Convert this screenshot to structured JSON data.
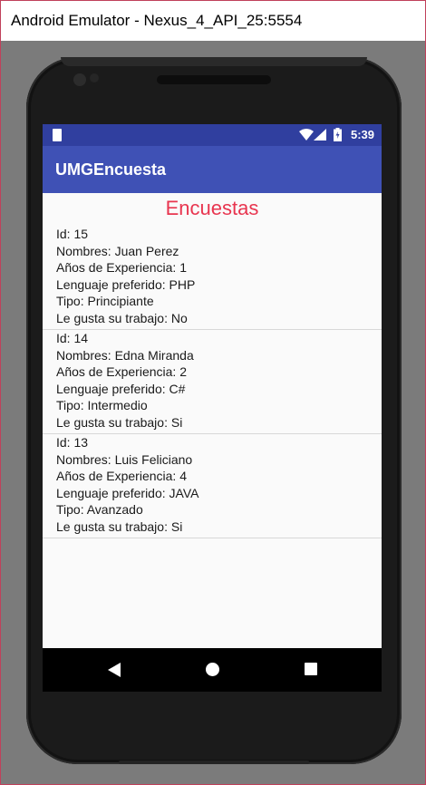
{
  "window": {
    "title": "Android Emulator - Nexus_4_API_25:5554"
  },
  "status_bar": {
    "time": "5:39",
    "icons": [
      "sim-card-icon",
      "wifi-icon",
      "cell-signal-icon",
      "battery-charging-icon"
    ]
  },
  "app_bar": {
    "title": "UMGEncuesta"
  },
  "main": {
    "heading": "Encuestas",
    "surveys": [
      {
        "id": "Id: 15",
        "nombres": "Nombres: Juan Perez",
        "experiencia": "Años de Experiencia: 1",
        "lenguaje": "Lenguaje preferido: PHP",
        "tipo": "Tipo: Principiante",
        "gusta": "Le gusta su trabajo: No"
      },
      {
        "id": "Id: 14",
        "nombres": "Nombres: Edna Miranda",
        "experiencia": "Años de Experiencia: 2",
        "lenguaje": "Lenguaje preferido: C#",
        "tipo": "Tipo: Intermedio",
        "gusta": "Le gusta su trabajo: Si"
      },
      {
        "id": "Id: 13",
        "nombres": "Nombres: Luis Feliciano",
        "experiencia": "Años de Experiencia: 4",
        "lenguaje": "Lenguaje preferido: JAVA",
        "tipo": "Tipo: Avanzado",
        "gusta": "Le gusta su trabajo: Si"
      }
    ]
  },
  "nav_bar": {
    "buttons": [
      "back-icon",
      "home-icon",
      "recent-apps-icon"
    ]
  },
  "colors": {
    "status_bar": "#303f9f",
    "app_bar": "#3f51b5",
    "heading": "#e8354f",
    "background": "#fafafa"
  }
}
